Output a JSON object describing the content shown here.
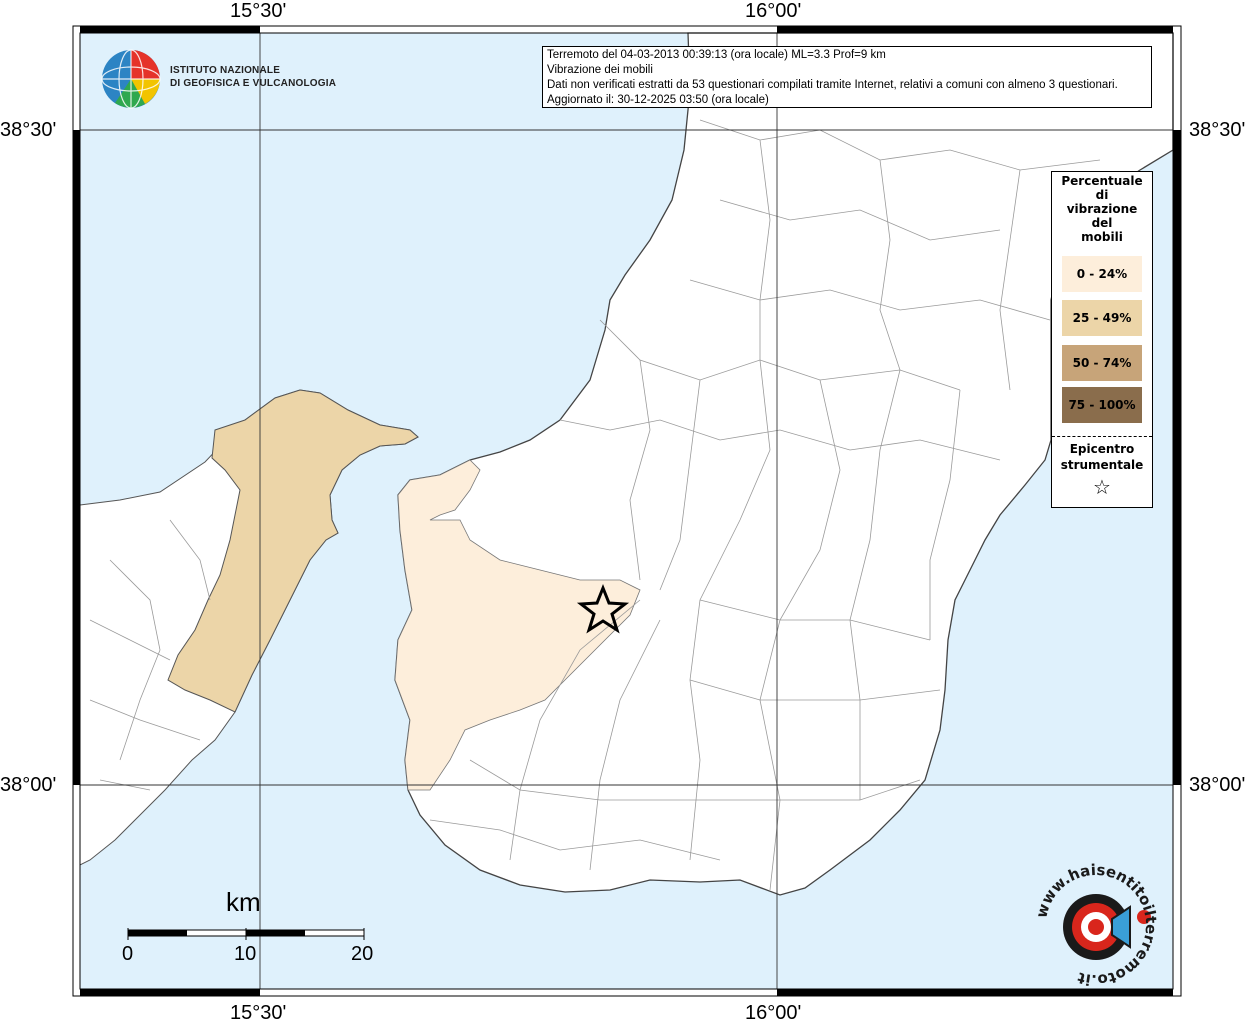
{
  "map": {
    "lon_labels": [
      "15°30'",
      "16°00'"
    ],
    "lat_labels": [
      "38°30'",
      "38°00'"
    ],
    "colors": {
      "sea": "#dff1fc",
      "land": "#ffffff",
      "class_0_24": "#fdeedb",
      "class_25_49": "#ecd5a8",
      "class_50_74": "#c7a479",
      "class_75_100": "#8a6d4c"
    }
  },
  "info": {
    "line1": "Terremoto del 04-03-2013 00:39:13 (ora locale) ML=3.3 Prof=9 km",
    "line2": "Vibrazione dei mobili",
    "line3": "Dati non verificati estratti da 53 questionari compilati tramite Internet, relativi a comuni con almeno 3 questionari.",
    "line4": "Aggiornato il: 30-12-2025 03:50 (ora locale)"
  },
  "logo": {
    "name_line1": "ISTITUTO NAZIONALE",
    "name_line2": "DI GEOFISICA E VULCANOLOGIA"
  },
  "legend": {
    "title_lines": [
      "Percentuale",
      "di",
      "vibrazione",
      "del",
      "mobili"
    ],
    "classes": [
      "0 - 24%",
      "25 - 49%",
      "50 - 74%",
      "75 - 100%"
    ],
    "epicenter_line1": "Epicentro",
    "epicenter_line2": "strumentale",
    "epicenter_symbol": "☆"
  },
  "scale": {
    "unit": "km",
    "ticks": [
      "0",
      "10",
      "20"
    ]
  },
  "watermark": {
    "text": "www.haisentitoilterremoto.it"
  }
}
